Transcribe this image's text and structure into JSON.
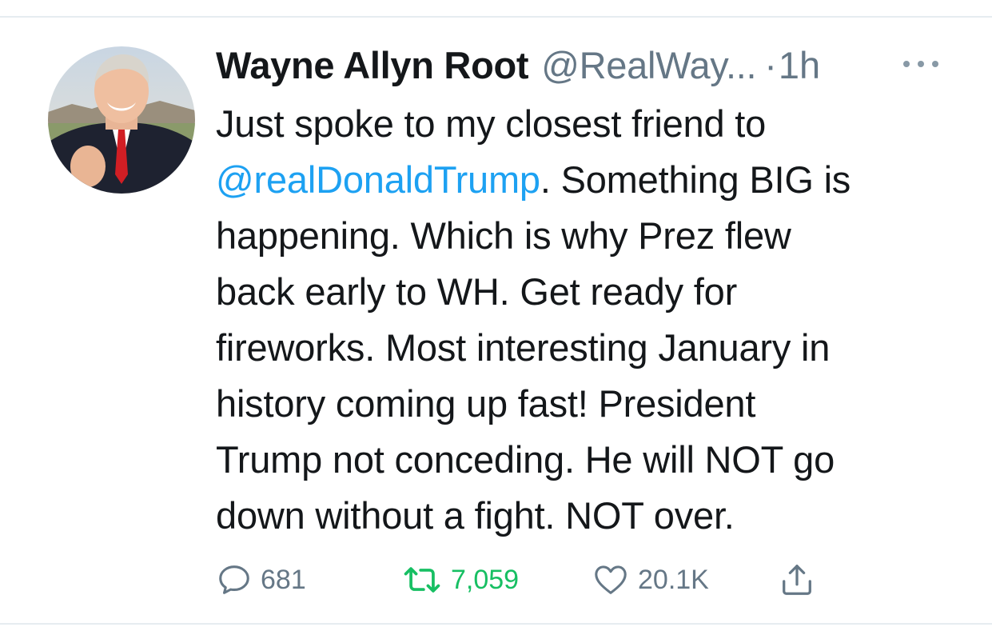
{
  "tweet": {
    "author": {
      "display_name": "Wayne Allyn Root",
      "handle": "@RealWay...",
      "avatar_icon": "profile-photo"
    },
    "separator": "·",
    "timestamp": "1h",
    "more_icon": "ellipsis-icon",
    "text_lines": {
      "l1": "Just spoke to my closest friend to",
      "l2_mention": "@realDonaldTrump",
      "l2_rest": ". Something BIG is",
      "l3": "happening. Which is why Prez flew",
      "l4": "back early to WH. Get ready for",
      "l5": "fireworks. Most interesting January in",
      "l6": "history coming up fast! President",
      "l7": "Trump not conceding. He will NOT go",
      "l8": "down without a fight. NOT over."
    },
    "actions": {
      "reply": {
        "icon": "reply-icon",
        "count": "681"
      },
      "retweet": {
        "icon": "retweet-icon",
        "count": "7,059",
        "active_color": "#17bf63"
      },
      "like": {
        "icon": "heart-icon",
        "count": "20.1K"
      },
      "share": {
        "icon": "share-icon"
      }
    }
  },
  "colors": {
    "text": "#14171a",
    "secondary": "#657786",
    "link": "#1da1f2",
    "retweet": "#17bf63",
    "divider": "#e6ecf0"
  }
}
